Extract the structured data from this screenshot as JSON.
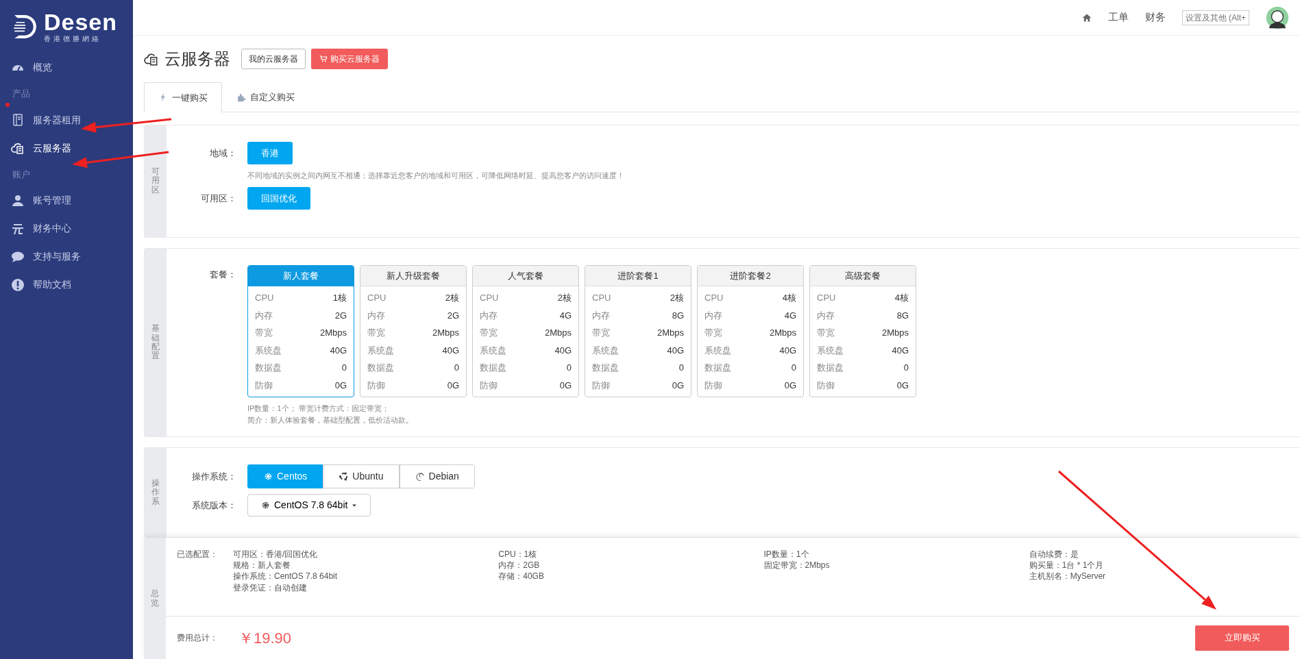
{
  "sidebar": {
    "logo": {
      "wordmark": "Desen",
      "tagline": "香港德勝網絡"
    },
    "groups": [
      {
        "items": [
          {
            "label": "概览",
            "selected": false
          }
        ]
      },
      {
        "heading": "产品",
        "items": [
          {
            "label": "服务器租用",
            "selected": false
          },
          {
            "label": "云服务器",
            "selected": true
          }
        ]
      },
      {
        "heading": "账户",
        "items": [
          {
            "label": "账号管理",
            "selected": false
          },
          {
            "label": "财务中心",
            "selected": false
          },
          {
            "label": "支持与服务",
            "selected": false
          },
          {
            "label": "帮助文档",
            "selected": false
          }
        ]
      }
    ]
  },
  "topbar": {
    "links": [
      "工单",
      "财务"
    ],
    "tooltip": "设置及其他 (Alt+"
  },
  "page": {
    "title": "云服务器",
    "buttons": [
      {
        "label": "我的云服务器",
        "kind": "outline"
      },
      {
        "label": "购买云服务器",
        "kind": "primary"
      }
    ]
  },
  "tabs": [
    {
      "label": "一键购买",
      "selected": true
    },
    {
      "label": "自定义购买",
      "selected": false
    }
  ],
  "zone_section": {
    "label": "可用区",
    "region_label": "地域：",
    "regions": [
      {
        "label": "香港",
        "selected": true
      }
    ],
    "hint": "不同地域的实例之间内网互不相通；选择靠近您客户的地域和可用区，可降低网络时延、提高您客户的访问速度！",
    "zone_label": "可用区：",
    "zones": [
      {
        "label": "回国优化",
        "selected": true
      }
    ]
  },
  "config_section": {
    "label": "基础配置",
    "plan_label": "套餐：",
    "plans": [
      {
        "name": "新人套餐",
        "selected": true,
        "specs": [
          [
            "CPU",
            "1核"
          ],
          [
            "内存",
            "2G"
          ],
          [
            "带宽",
            "2Mbps"
          ],
          [
            "系统盘",
            "40G"
          ],
          [
            "数据盘",
            "0"
          ],
          [
            "防御",
            "0G"
          ]
        ]
      },
      {
        "name": "新人升级套餐",
        "selected": false,
        "specs": [
          [
            "CPU",
            "2核"
          ],
          [
            "内存",
            "2G"
          ],
          [
            "带宽",
            "2Mbps"
          ],
          [
            "系统盘",
            "40G"
          ],
          [
            "数据盘",
            "0"
          ],
          [
            "防御",
            "0G"
          ]
        ]
      },
      {
        "name": "人气套餐",
        "selected": false,
        "specs": [
          [
            "CPU",
            "2核"
          ],
          [
            "内存",
            "4G"
          ],
          [
            "带宽",
            "2Mbps"
          ],
          [
            "系统盘",
            "40G"
          ],
          [
            "数据盘",
            "0"
          ],
          [
            "防御",
            "0G"
          ]
        ]
      },
      {
        "name": "进阶套餐1",
        "selected": false,
        "specs": [
          [
            "CPU",
            "2核"
          ],
          [
            "内存",
            "8G"
          ],
          [
            "带宽",
            "2Mbps"
          ],
          [
            "系统盘",
            "40G"
          ],
          [
            "数据盘",
            "0"
          ],
          [
            "防御",
            "0G"
          ]
        ]
      },
      {
        "name": "进阶套餐2",
        "selected": false,
        "specs": [
          [
            "CPU",
            "4核"
          ],
          [
            "内存",
            "4G"
          ],
          [
            "带宽",
            "2Mbps"
          ],
          [
            "系统盘",
            "40G"
          ],
          [
            "数据盘",
            "0"
          ],
          [
            "防御",
            "0G"
          ]
        ]
      },
      {
        "name": "高级套餐",
        "selected": false,
        "specs": [
          [
            "CPU",
            "4核"
          ],
          [
            "内存",
            "8G"
          ],
          [
            "带宽",
            "2Mbps"
          ],
          [
            "系统盘",
            "40G"
          ],
          [
            "数据盘",
            "0"
          ],
          [
            "防御",
            "0G"
          ]
        ]
      }
    ],
    "notes": [
      "IP数量：1个； 带宽计费方式：固定带宽；",
      "简介：新人体验套餐，基础型配置，低价活动款。"
    ]
  },
  "os_section": {
    "label": "操作系",
    "os_label": "操作系统：",
    "systems": [
      {
        "name": "Centos",
        "selected": true
      },
      {
        "name": "Ubuntu",
        "selected": false
      },
      {
        "name": "Debian",
        "selected": false
      }
    ],
    "version_label": "系统版本：",
    "version": "CentOS 7.8 64bit"
  },
  "summary": {
    "label": "总览",
    "selected_label": "已选配置：",
    "columns": [
      [
        "可用区：香港/回国优化",
        "规格：新人套餐",
        "操作系统：CentOS 7.8 64bit",
        "登录凭证：自动创建"
      ],
      [
        "CPU：1核",
        "内存：2GB",
        "存储：40GB"
      ],
      [
        "IP数量：1个",
        "固定带宽：2Mbps"
      ],
      [
        "自动续费：是",
        "购买量：1台 * 1个月",
        "主机别名：MyServer"
      ]
    ],
    "total_label": "费用总计：",
    "total": "￥19.90",
    "buy_button": "立即购买"
  }
}
